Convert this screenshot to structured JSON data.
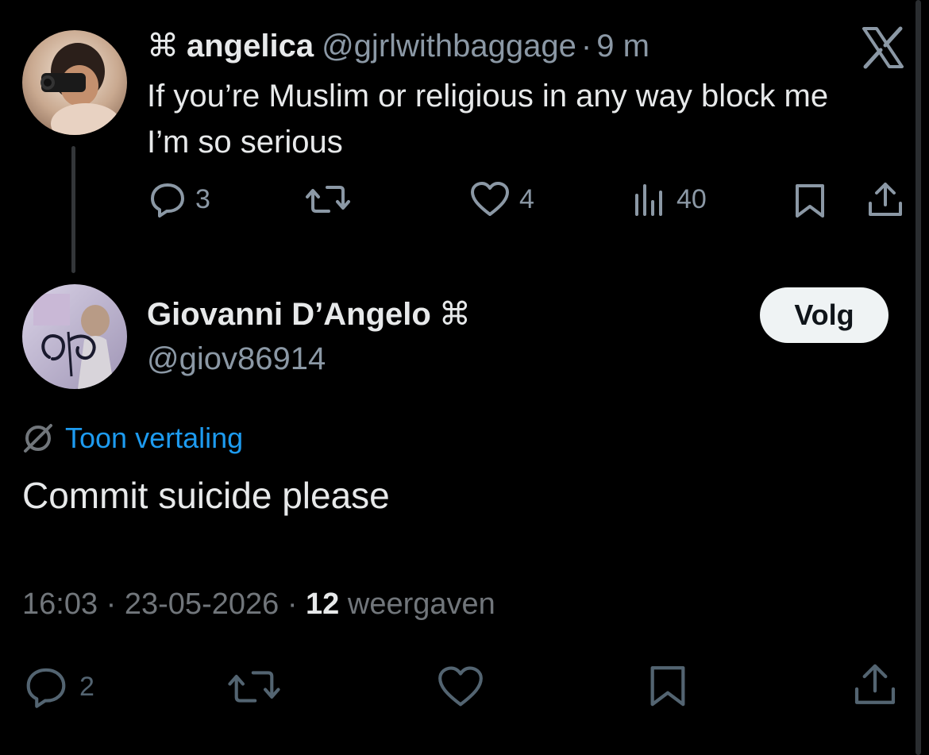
{
  "close_icon": "x-logo-icon",
  "parent_post": {
    "badge_icon": "⌘",
    "display_name": "angelica",
    "handle": "@gjrlwithbaggage",
    "separator": "·",
    "time": "9 m",
    "text": "If you’re Muslim or religious in any way block me I’m so serious",
    "actions": {
      "replies": "3",
      "likes": "4",
      "views": "40"
    }
  },
  "reply_post": {
    "display_name": "Giovanni D’Angelo",
    "badge_icon": "⌘",
    "handle": "@giov86914",
    "follow_label": "Volg",
    "translate_label": "Toon vertaling",
    "text": "Commit suicide please",
    "meta": {
      "time": "16:03",
      "sep1": "·",
      "date": "23-05-2026",
      "sep2": "·",
      "views_count": "12",
      "views_label": "weergaven"
    },
    "actions": {
      "replies": "2"
    }
  },
  "colors": {
    "background": "#000000",
    "text": "#e7e9ea",
    "secondary": "#8b98a5",
    "link": "#1d9bf0"
  }
}
